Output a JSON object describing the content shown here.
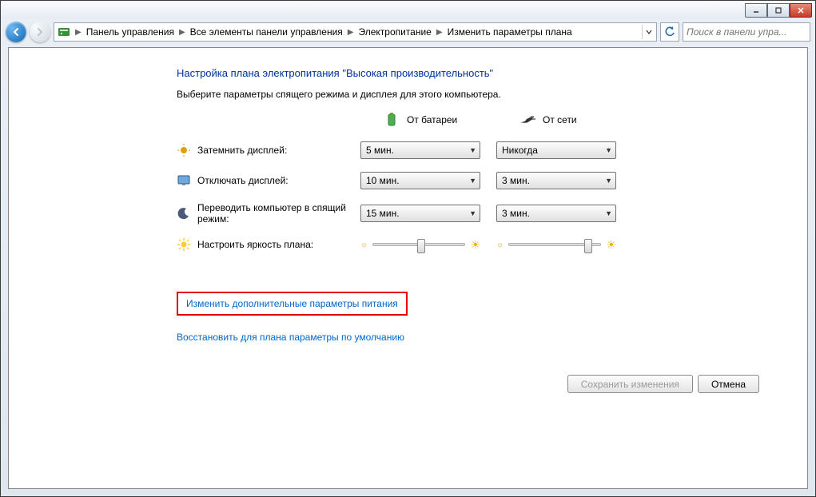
{
  "breadcrumb": {
    "items": [
      "Панель управления",
      "Все элементы панели управления",
      "Электропитание",
      "Изменить параметры плана"
    ]
  },
  "search": {
    "placeholder": "Поиск в панели упра..."
  },
  "heading": "Настройка плана электропитания \"Высокая производительность\"",
  "subtitle": "Выберите параметры спящего режима и дисплея для этого компьютера.",
  "columns": {
    "battery": "От батареи",
    "ac": "От сети"
  },
  "rows": {
    "dim": {
      "label": "Затемнить дисплей:",
      "battery": "5 мин.",
      "ac": "Никогда"
    },
    "off": {
      "label": "Отключать дисплей:",
      "battery": "10 мин.",
      "ac": "3 мин."
    },
    "sleep": {
      "label": "Переводить компьютер в спящий режим:",
      "battery": "15 мин.",
      "ac": "3 мин."
    },
    "bright": {
      "label": "Настроить яркость плана:"
    }
  },
  "sliders": {
    "battery_pct": 48,
    "ac_pct": 82
  },
  "links": {
    "advanced": "Изменить дополнительные параметры питания",
    "restore": "Восстановить для плана параметры по умолчанию"
  },
  "buttons": {
    "save": "Сохранить изменения",
    "cancel": "Отмена"
  }
}
